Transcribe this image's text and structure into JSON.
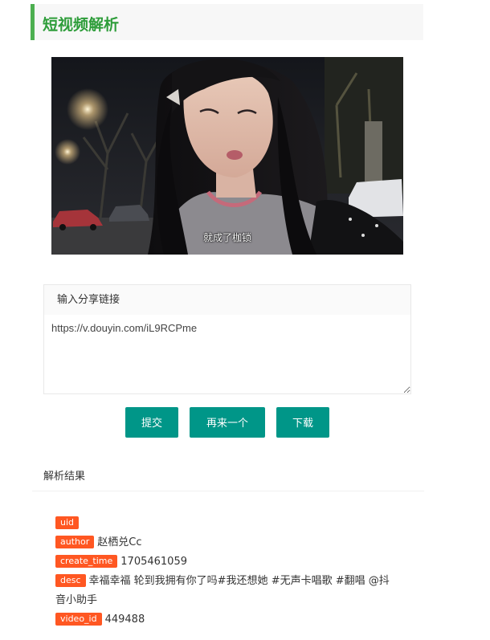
{
  "page": {
    "title": "短视频解析"
  },
  "video": {
    "subtitle": "就成了枷锁"
  },
  "input": {
    "header": "输入分享链接",
    "value": "https://v.douyin.com/iL9RCPme"
  },
  "buttons": {
    "submit": "提交",
    "again": "再来一个",
    "download": "下载"
  },
  "result": {
    "title": "解析结果",
    "fields": {
      "uid_label": "uid",
      "uid_value": "",
      "author_label": "author",
      "author_value": "赵栖兑Cc",
      "create_time_label": "create_time",
      "create_time_value": "1705461059",
      "desc_label": "desc",
      "desc_value": "幸福幸福 轮到我拥有你了吗#我还想她 #无声卡唱歌 #翻唱 @抖音小助手",
      "video_id_label": "video_id",
      "video_id_value": "449488"
    }
  },
  "colors": {
    "accent_green": "#2e9d3a",
    "button_teal": "#009688",
    "tag_orange": "#ff5722"
  }
}
